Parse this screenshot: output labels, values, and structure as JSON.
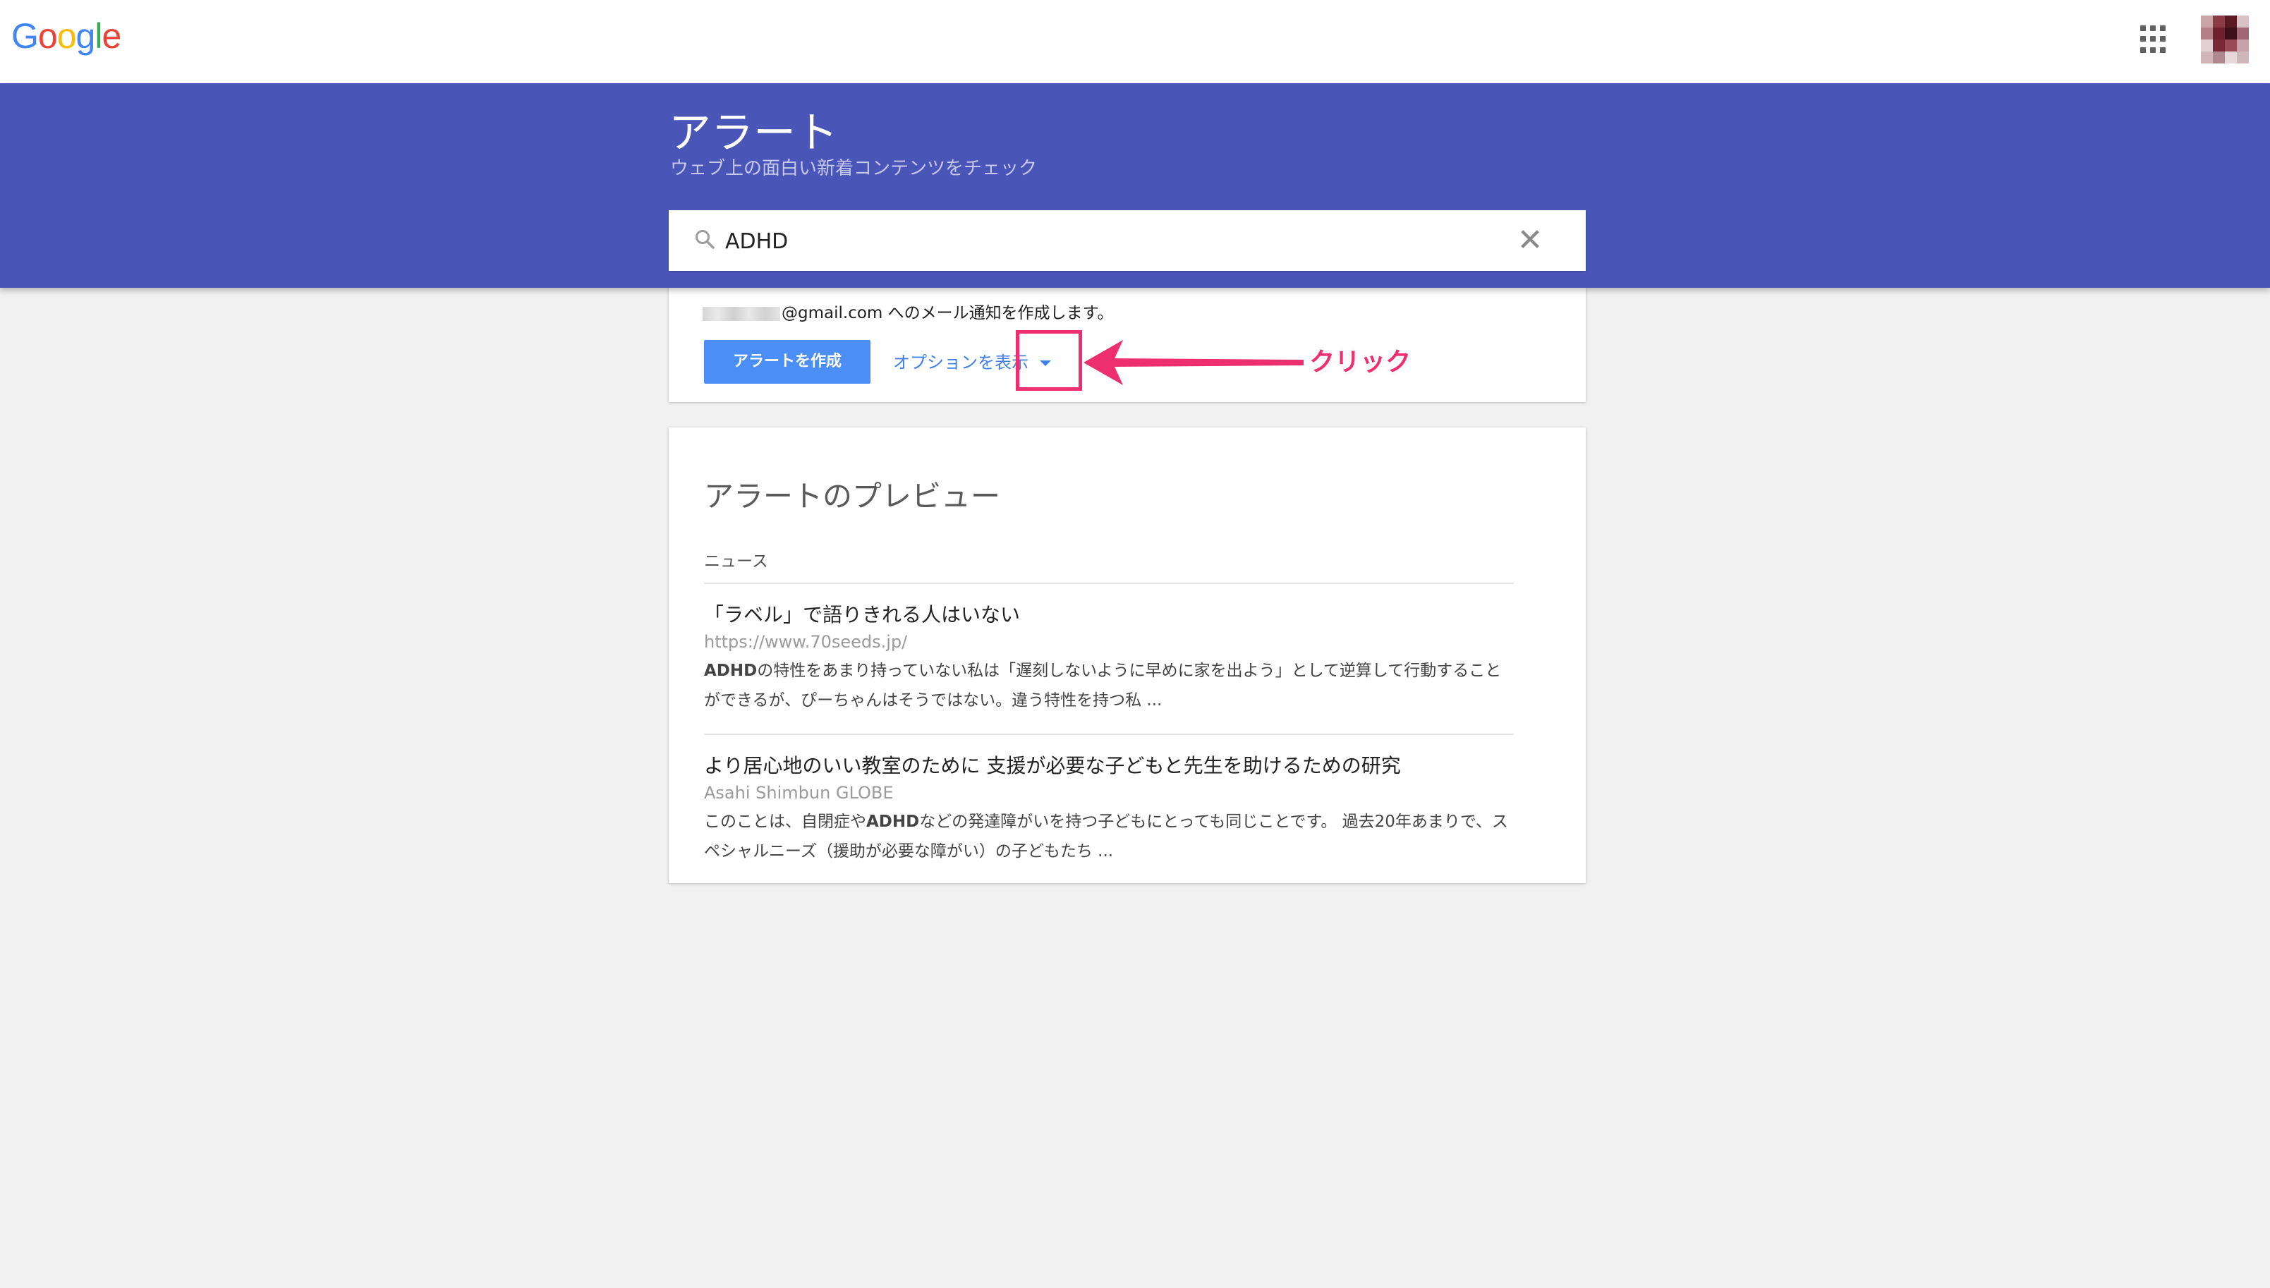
{
  "header": {
    "logo_letters": [
      {
        "ch": "G",
        "color": "#4285F4"
      },
      {
        "ch": "o",
        "color": "#EA4335"
      },
      {
        "ch": "o",
        "color": "#FBBC05"
      },
      {
        "ch": "g",
        "color": "#4285F4"
      },
      {
        "ch": "l",
        "color": "#34A853"
      },
      {
        "ch": "e",
        "color": "#EA4335"
      }
    ],
    "apps_icon": "apps-grid-icon",
    "avatar_icon": "user-avatar"
  },
  "banner": {
    "title": "アラート",
    "subtitle": "ウェブ上の面白い新着コンテンツをチェック",
    "color": "#4a55b8"
  },
  "search": {
    "value": "ADHD",
    "icon": "search-icon",
    "clear_icon": "close-icon",
    "clear_glyph": "✕"
  },
  "create": {
    "email_text": "@gmail.com へのメール通知を作成します。",
    "create_button": "アラートを作成",
    "options_link": "オプションを表示",
    "button_color": "#4b8ef5"
  },
  "preview": {
    "title": "アラートのプレビュー",
    "section": "ニュース",
    "items": [
      {
        "title": "「ラベル」で語りきれる人はいない",
        "source": "https://www.70seeds.jp/",
        "snippet_bold": "ADHD",
        "snippet_rest": "の特性をあまり持っていない私は「遅刻しないように早めに家を出よう」として逆算して行動することができるが、ぴーちゃんはそうではない。違う特性を持つ私 ..."
      },
      {
        "title": "より居心地のいい教室のために 支援が必要な子どもと先生を助けるための研究",
        "source": "Asahi Shimbun GLOBE",
        "snippet_pre": "このことは、自閉症や",
        "snippet_bold": "ADHD",
        "snippet_rest": "などの発達障がいを持つ子どもにとっても同じことです。 過去20年あまりで、スペシャルニーズ（援助が必要な障がい）の子どもたち ..."
      }
    ]
  },
  "annotation": {
    "label": "クリック",
    "color": "#ee2f6f"
  }
}
